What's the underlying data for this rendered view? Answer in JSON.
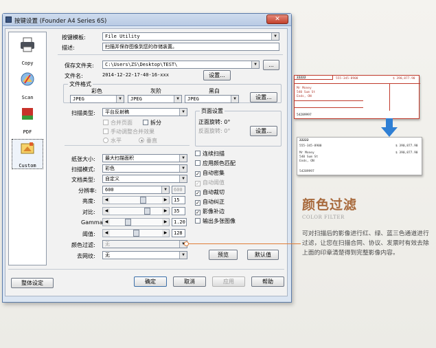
{
  "window": {
    "title": "按键设置 (Founder A4 Series 6S)",
    "close_label": "✕"
  },
  "sidebar": {
    "items": [
      {
        "label": "Copy",
        "icon": "printer-icon"
      },
      {
        "label": "Scan",
        "icon": "scan-icon"
      },
      {
        "label": "PDF",
        "icon": "pdf-icon"
      },
      {
        "label": "Custom",
        "icon": "custom-icon",
        "selected": true
      }
    ]
  },
  "form": {
    "template_label": "按键模板:",
    "template_value": "File Utility",
    "desc_label": "描述:",
    "desc_value": "扫描并保存图像到您的存储装置。",
    "save_folder_label": "保存文件夹:",
    "save_folder_value": "C:\\Users\\ZS\\Desktop\\TEST\\",
    "browse_label": "...",
    "filename_label": "文件名:",
    "filename_value": "2014-12-22-17-40-16-xxx",
    "filename_settings": "设置...",
    "file_format_group": "文件格式",
    "format_color_label": "彩色",
    "format_color_value": "JPEG",
    "format_gray_label": "灰阶",
    "format_gray_value": "JPEG",
    "format_bw_label": "黑白",
    "format_bw_value": "JPEG",
    "format_settings": "设置...",
    "scan_type_label": "扫描类型:",
    "scan_type_value": "平台反射稿",
    "merge_label": "合并页面",
    "split_label": "拆分",
    "manual_merge_label": "手动调整合并效果",
    "horizontal_label": "水平",
    "vertical_label": "垂直",
    "page_setup_group": "页面设置",
    "front_rotation": "正面旋转: 0°",
    "back_rotation": "反面旋转: 0°",
    "page_settings": "设置...",
    "continuous_scan": "连续扫描",
    "apply_color_match": "应用颜色匹配",
    "auto_density": "自动密集",
    "auto_threshold": "自动阈值",
    "auto_crop": "自动裁切",
    "auto_deskew": "自动纠正",
    "image_fill": "影像补边",
    "output_multi": "输出多张图像",
    "paper_size_label": "纸张大小:",
    "paper_size_value": "最大扫描面积",
    "scan_mode_label": "扫描模式:",
    "scan_mode_value": "彩色",
    "doc_type_label": "文档类型:",
    "doc_type_value": "自定义",
    "resolution_label": "分辨率:",
    "resolution_value": "600",
    "resolution_max": "600",
    "brightness_label": "亮度:",
    "brightness_value": "15",
    "contrast_label": "对比:",
    "contrast_value": "35",
    "gamma_label": "Gamma:",
    "gamma_value": "1.20",
    "threshold_label": "阈值:",
    "threshold_value": "128",
    "color_filter_label": "颜色过滤:",
    "color_filter_value": "无",
    "descreen_label": "去网纹:",
    "descreen_value": "无",
    "preview_button": "预览",
    "default_button": "默认值"
  },
  "bottom": {
    "global_settings": "整体设定",
    "ok": "确定",
    "cancel": "取消",
    "apply": "应用",
    "help": "帮助"
  },
  "feature": {
    "title": "颜色过滤",
    "subtitle": "COLOR FILTER",
    "body": "可对扫描后的影像进行红、绿、蓝三色通道进行过滤，让您在扫描合同、协议、发票时有效去除上面的印章清楚得到完整影像内容。"
  },
  "example_docs": {
    "before": [
      "22222",
      "555-345-8900",
      "$ 390,877.90",
      "Mr Money",
      "540 Sum St",
      "Ends, ON",
      "54289997"
    ],
    "after": [
      "22222",
      "555-345-8900",
      "$ 390,877.90",
      "Mr Money",
      "540 Sum St",
      "Ends, ON",
      "$ 390,877.90",
      "54289997"
    ]
  },
  "colors": {
    "accent_orange": "#e07c35",
    "title_brown": "#a86a3d",
    "stamp_red": "#c0392b",
    "arrow_blue": "#2f7fd4"
  }
}
